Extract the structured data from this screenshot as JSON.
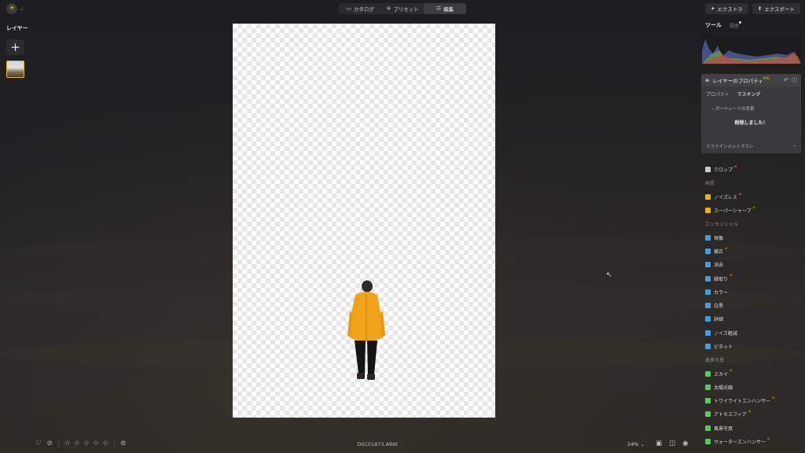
{
  "header": {
    "tabs": [
      {
        "label": "カタログ",
        "icon": "folder-icon"
      },
      {
        "label": "プリセット",
        "icon": "presets-icon"
      },
      {
        "label": "編集",
        "icon": "edit-icon"
      }
    ],
    "active_tab": "編集",
    "extra_label": "エクストラ",
    "export_label": "エクスポート"
  },
  "left": {
    "title": "レイヤー",
    "add_label": "+"
  },
  "bottom": {
    "filename": "DSC01873.ARW",
    "zoom": "24%",
    "rating": 0
  },
  "right": {
    "tab_tools": "ツール",
    "tab_history": "履歴",
    "layer_panel": {
      "title": "レイヤーのプロパティ",
      "pro_badge": "PRO",
      "subtabs": [
        "プロパティ",
        "マスキング"
      ],
      "back_label": "ポートレートの背景",
      "message": "削除しました！",
      "refine_label": "リファインメントブラシ"
    },
    "tools": [
      {
        "label": "クロップ",
        "pro": "AI",
        "icon_color": "#cccccc",
        "kind": "tool"
      },
      {
        "label": "画質",
        "kind": "section"
      },
      {
        "label": "ノイズレス",
        "pro": "AI",
        "icon_color": "#f0b400",
        "kind": "tool"
      },
      {
        "label": "スーパーシャープ",
        "pro": "AI",
        "icon_color": "#f0b400",
        "kind": "tool"
      },
      {
        "label": "エッセンシャル",
        "kind": "section"
      },
      {
        "label": "現像",
        "icon_color": "#3aa0e8",
        "kind": "tool"
      },
      {
        "label": "補正",
        "pro": "AI",
        "icon_color": "#3aa0e8",
        "kind": "tool"
      },
      {
        "label": "消去",
        "icon_color": "#3aa0e8",
        "kind": "tool"
      },
      {
        "label": "縁取り",
        "pro": "AI",
        "icon_color": "#3aa0e8",
        "kind": "tool"
      },
      {
        "label": "カラー",
        "icon_color": "#3aa0e8",
        "kind": "tool"
      },
      {
        "label": "白黒",
        "icon_color": "#3aa0e8",
        "kind": "tool"
      },
      {
        "label": "詳細",
        "icon_color": "#3aa0e8",
        "kind": "tool"
      },
      {
        "label": "ノイズ軽減",
        "icon_color": "#3aa0e8",
        "kind": "tool"
      },
      {
        "label": "ビネット",
        "icon_color": "#3aa0e8",
        "kind": "tool"
      },
      {
        "label": "風景写真",
        "kind": "section"
      },
      {
        "label": "スカイ",
        "pro": "AI",
        "icon_color": "#4cd05a",
        "kind": "tool"
      },
      {
        "label": "太陽光線",
        "icon_color": "#4cd05a",
        "kind": "tool"
      },
      {
        "label": "トワイライトエンハンサー",
        "pro": "AI",
        "icon_color": "#4cd05a",
        "kind": "tool"
      },
      {
        "label": "アトモスフィア",
        "pro": "AI",
        "icon_color": "#4cd05a",
        "kind": "tool"
      },
      {
        "label": "風景写真",
        "icon_color": "#4cd05a",
        "kind": "tool"
      },
      {
        "label": "ウォーターエンハンサー",
        "pro": "AI",
        "icon_color": "#4cd05a",
        "kind": "tool"
      }
    ]
  }
}
